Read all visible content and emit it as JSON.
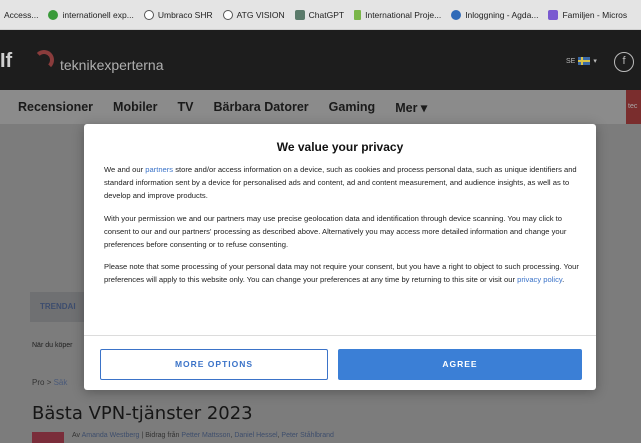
{
  "bookmarks": [
    {
      "label": "Access...",
      "icon": "none",
      "color": ""
    },
    {
      "label": "internationell exp...",
      "icon": "leaf-icon",
      "color": "#3a9a3a"
    },
    {
      "label": "Umbraco SHR",
      "icon": "globe-icon",
      "color": "#555555"
    },
    {
      "label": "ATG VISION",
      "icon": "globe-icon",
      "color": "#555555"
    },
    {
      "label": "ChatGPT",
      "icon": "chat-icon",
      "color": "#5a7a6a"
    },
    {
      "label": "International Proje...",
      "icon": "flag-icon",
      "color": "#7ab648"
    },
    {
      "label": "Inloggning - Agda...",
      "icon": "key-icon",
      "color": "#2f6ab8"
    },
    {
      "label": "Familjen - Micros",
      "icon": "teams-icon",
      "color": "#7a5ad0"
    }
  ],
  "header": {
    "logo_mark": "If",
    "logo_text": "teknikexperterna",
    "lang": "SE",
    "facebook_glyph": "f"
  },
  "nav": {
    "items": [
      "Recensioner",
      "Mobiler",
      "TV",
      "Bärbara Datorer",
      "Gaming",
      "Mer ▾"
    ],
    "right_tab": "tec"
  },
  "page": {
    "trending": "TRENDAI",
    "teaser": "När du köper",
    "breadcrumb_home": "Pro",
    "breadcrumb_sep": ">",
    "breadcrumb_next": "Säk",
    "article_title": "Bästa VPN-tjänster 2023",
    "byline_prefix": "Av",
    "byline_author": "Amanda Westberg",
    "byline_sep": "|",
    "byline_contrib_prefix": "Bidrag från",
    "byline_contrib_1": "Petter Mattsson",
    "byline_contrib_2": "Daniel Hessel",
    "byline_contrib_3": "Peter Ståhlbrand"
  },
  "consent": {
    "title": "We value your privacy",
    "p1_a": "We and our ",
    "p1_link": "partners",
    "p1_b": " store and/or access information on a device, such as cookies and process personal data, such as unique identifiers and standard information sent by a device for personalised ads and content, ad and content measurement, and audience insights, as well as to develop and improve products.",
    "p2": "With your permission we and our partners may use precise geolocation data and identification through device scanning. You may click to consent to our and our partners' processing as described above. Alternatively you may access more detailed information and change your preferences before consenting or to refuse consenting.",
    "p3_a": "Please note that some processing of your personal data may not require your consent, but you have a right to object to such processing. Your preferences will apply to this website only. You can change your preferences at any time by returning to this site or visit our ",
    "p3_link": "privacy policy",
    "p3_b": ".",
    "more_options": "MORE OPTIONS",
    "agree": "AGREE"
  }
}
